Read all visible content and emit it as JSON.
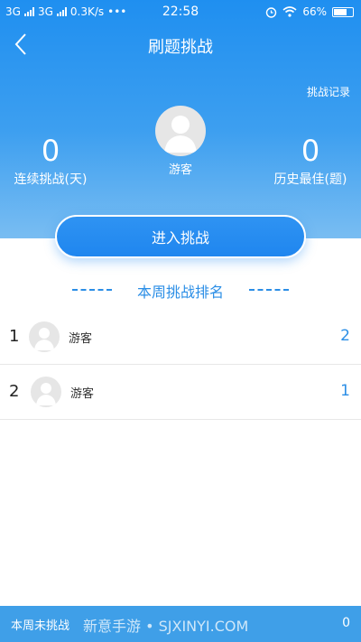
{
  "status_bar": {
    "net1": "3G",
    "net2": "3G",
    "speed": "0.3K/s",
    "time": "22:58",
    "battery": "66%"
  },
  "nav": {
    "title": "刷题挑战"
  },
  "hero": {
    "record_link": "挑战记录",
    "user_name": "游客",
    "streak_value": "0",
    "streak_label": "连续挑战(天)",
    "best_value": "0",
    "best_label": "历史最佳(题)"
  },
  "enter_button": "进入挑战",
  "ranking": {
    "title": "本周挑战排名",
    "rows": [
      {
        "rank": "1",
        "name": "游客",
        "score": "2"
      },
      {
        "rank": "2",
        "name": "游客",
        "score": "1"
      }
    ]
  },
  "footer": {
    "label": "本周未挑战",
    "watermark": "新意手游 • SJXINYI.COM",
    "value": "0"
  },
  "colors": {
    "primary": "#1f8ff0",
    "accent_text": "#2b8ee6",
    "footer_bg": "#3f9fe8"
  },
  "icons": [
    "back-arrow-icon",
    "signal-icon",
    "alarm-icon",
    "wifi-icon",
    "battery-icon",
    "avatar-placeholder-icon"
  ]
}
